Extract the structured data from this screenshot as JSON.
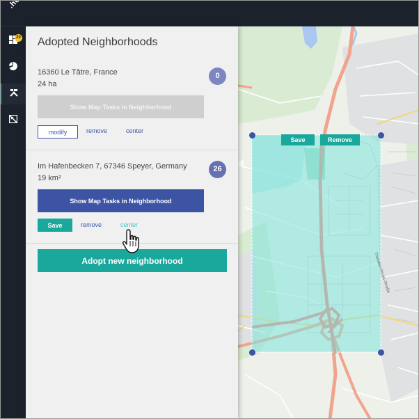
{
  "app": {
    "logo_text": ".here"
  },
  "nav": {
    "badge": "20",
    "items": [
      {
        "icon": "dashboard-icon"
      },
      {
        "icon": "pie-chart-icon"
      },
      {
        "icon": "tools-icon"
      },
      {
        "icon": "map-tasks-icon"
      }
    ]
  },
  "panel": {
    "title": "Adopted Neighborhoods",
    "neighborhoods": [
      {
        "address": "16360 Le Tâtre, France",
        "area": "24 ha",
        "count": "0",
        "count_color": "#7b86c2",
        "show_tasks_label": "Show Map Tasks in Neighborhood",
        "show_tasks_enabled": false,
        "primary_action": "modify",
        "remove_label": "remove",
        "center_label": "center"
      },
      {
        "address": "Im Hafenbecken 7, 67346 Speyer, Germany",
        "area": "19 km²",
        "count": "26",
        "count_color": "#6571b0",
        "show_tasks_label": "Show Map Tasks in Neighborhood",
        "show_tasks_enabled": true,
        "primary_action": "Save",
        "remove_label": "remove",
        "center_label": "center"
      }
    ],
    "adopt_label": "Adopt new neighborhood"
  },
  "map": {
    "save_label": "Save",
    "remove_label": "Remove",
    "street_label": "Theodor-Heuss-Straße",
    "selection_color": "#7fe3dc",
    "accent": "#1ba89c",
    "primary": "#3d54a5"
  }
}
